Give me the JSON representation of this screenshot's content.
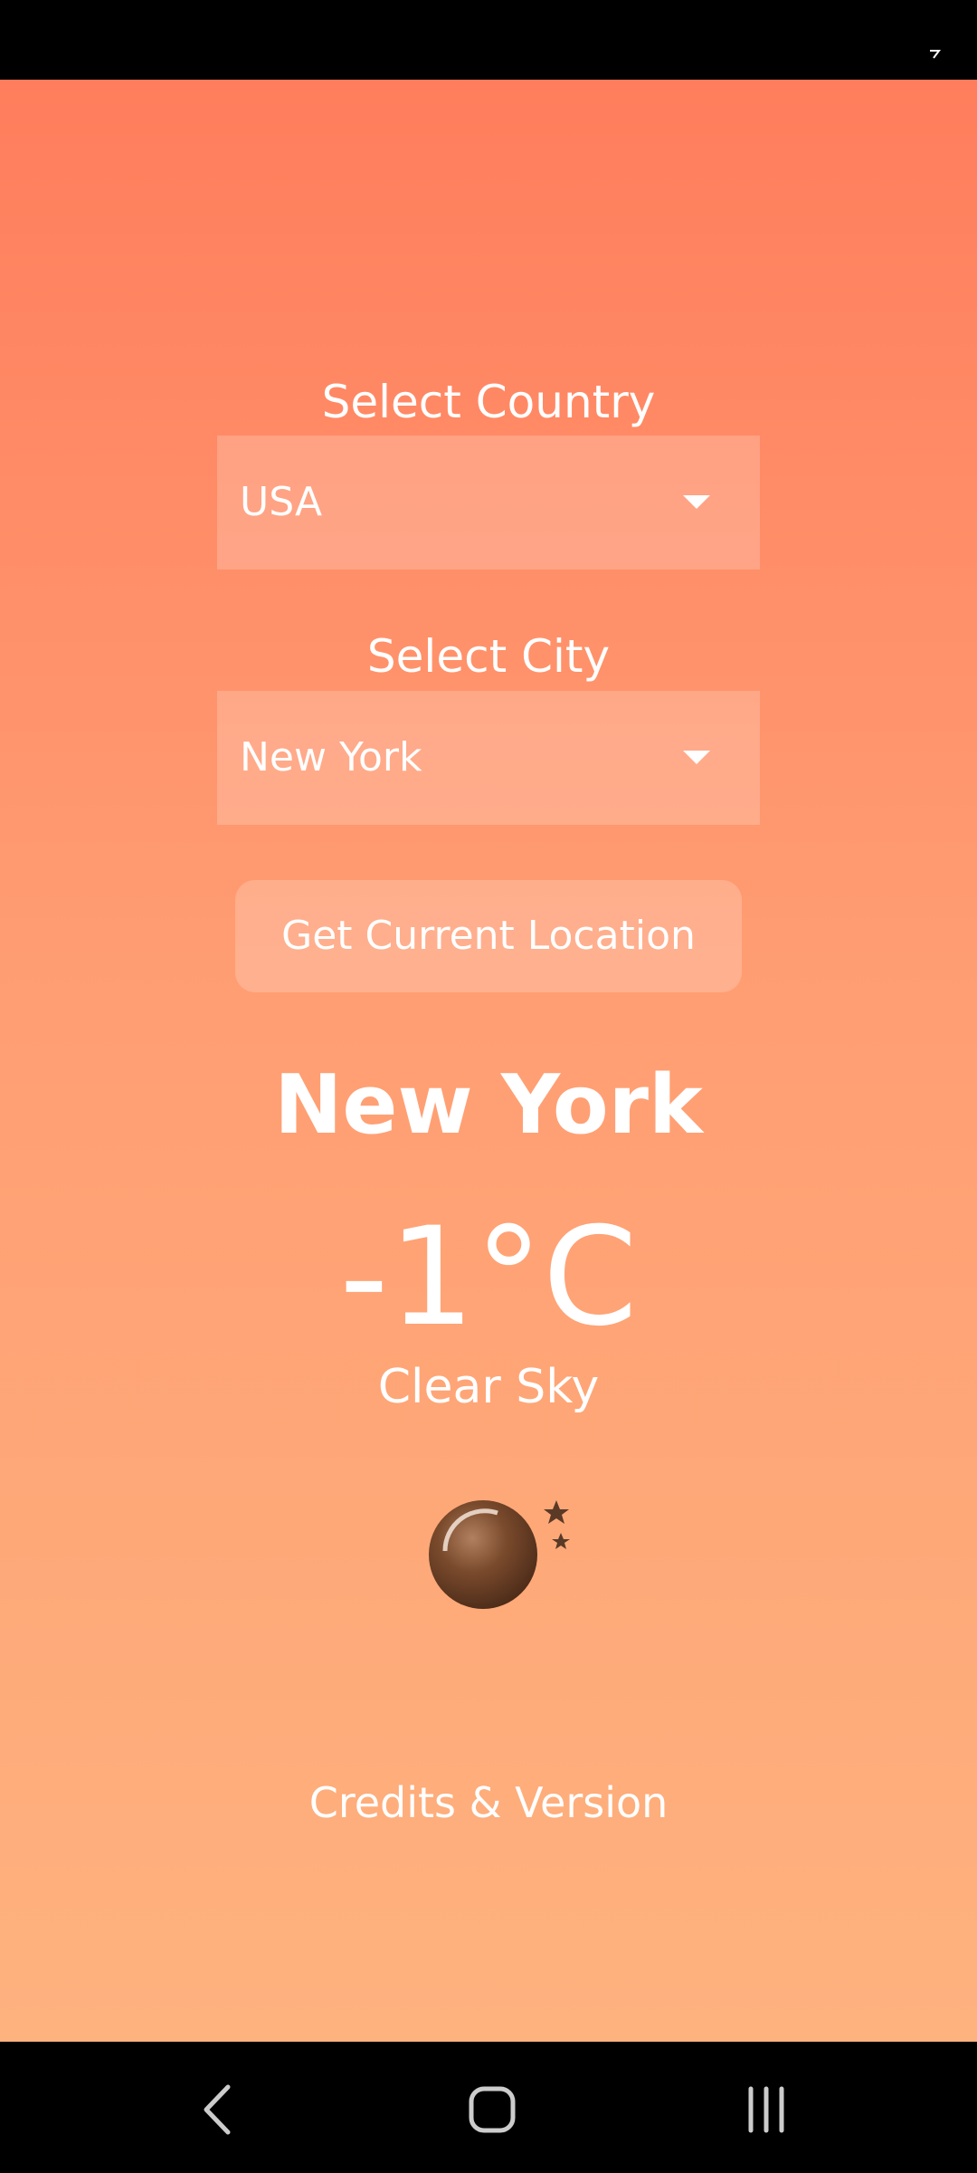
{
  "status_bar": {
    "icon": "signal-icon"
  },
  "country": {
    "label": "Select Country",
    "selected": "USA"
  },
  "city": {
    "label": "Select City",
    "selected": "New York"
  },
  "location_button_label": "Get Current Location",
  "weather": {
    "city_name": "New York",
    "temperature": "-1°C",
    "condition": "Clear Sky",
    "icon": "moon-stars-icon"
  },
  "credits_label": "Credits & Version",
  "nav_bar": {
    "back": "back-icon",
    "home": "home-icon",
    "recents": "recents-icon"
  },
  "colors": {
    "gradient_top": "#ff7d5c",
    "gradient_bottom": "#feb27e",
    "text": "#ffffff"
  }
}
